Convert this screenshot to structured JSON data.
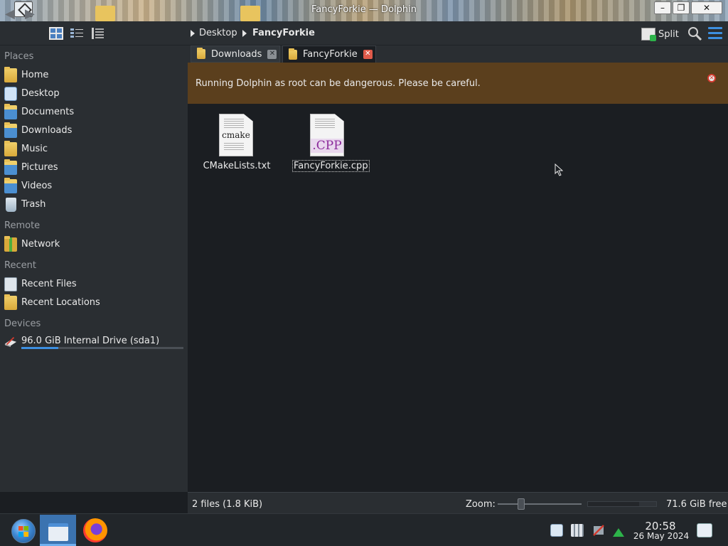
{
  "window": {
    "title": "FancyForkie — Dolphin",
    "min": "–",
    "max": "❐",
    "close": "✕"
  },
  "toolbar": {
    "back": "◀",
    "forward": "▶",
    "breadcrumb": [
      "Desktop",
      "FancyForkie"
    ],
    "split_label": "Split"
  },
  "sidebar": {
    "places_title": "Places",
    "places": [
      {
        "label": "Home",
        "icon": "home-folder-icon"
      },
      {
        "label": "Desktop",
        "icon": "desktop-icon"
      },
      {
        "label": "Documents",
        "icon": "documents-folder-icon"
      },
      {
        "label": "Downloads",
        "icon": "downloads-folder-icon"
      },
      {
        "label": "Music",
        "icon": "music-folder-icon"
      },
      {
        "label": "Pictures",
        "icon": "pictures-folder-icon"
      },
      {
        "label": "Videos",
        "icon": "videos-folder-icon"
      },
      {
        "label": "Trash",
        "icon": "trash-icon"
      }
    ],
    "remote_title": "Remote",
    "remote": [
      {
        "label": "Network",
        "icon": "network-icon"
      }
    ],
    "recent_title": "Recent",
    "recent": [
      {
        "label": "Recent Files",
        "icon": "recent-files-icon"
      },
      {
        "label": "Recent Locations",
        "icon": "recent-locations-icon"
      }
    ],
    "devices_title": "Devices",
    "devices": [
      {
        "label": "96.0 GiB Internal Drive (sda1)",
        "icon": "hard-drive-icon",
        "usage_fraction": 0.23
      }
    ]
  },
  "tabs": [
    {
      "label": "Downloads",
      "close": "✕",
      "active": false
    },
    {
      "label": "FancyForkie",
      "close": "✕",
      "active": true
    }
  ],
  "warning": {
    "text": "Running Dolphin as root can be dangerous. Please be careful.",
    "close": "✕"
  },
  "files": [
    {
      "name": "CMakeLists.txt",
      "glyph": "cmake",
      "selected": false
    },
    {
      "name": "FancyForkie.cpp",
      "glyph": ".CPP",
      "selected": true
    }
  ],
  "statusbar": {
    "summary": "2 files (1.8 KiB)",
    "zoom_label": "Zoom:",
    "zoom_fraction": 0.28,
    "free_space": "71.6 GiB free",
    "free_fraction": 0.75
  },
  "taskbar": {
    "time": "20:58",
    "date": "26 May 2024"
  },
  "colors": {
    "accent": "#3d8fe0",
    "warning_bg": "#5b3f1d",
    "close_red": "#e05a4a"
  }
}
